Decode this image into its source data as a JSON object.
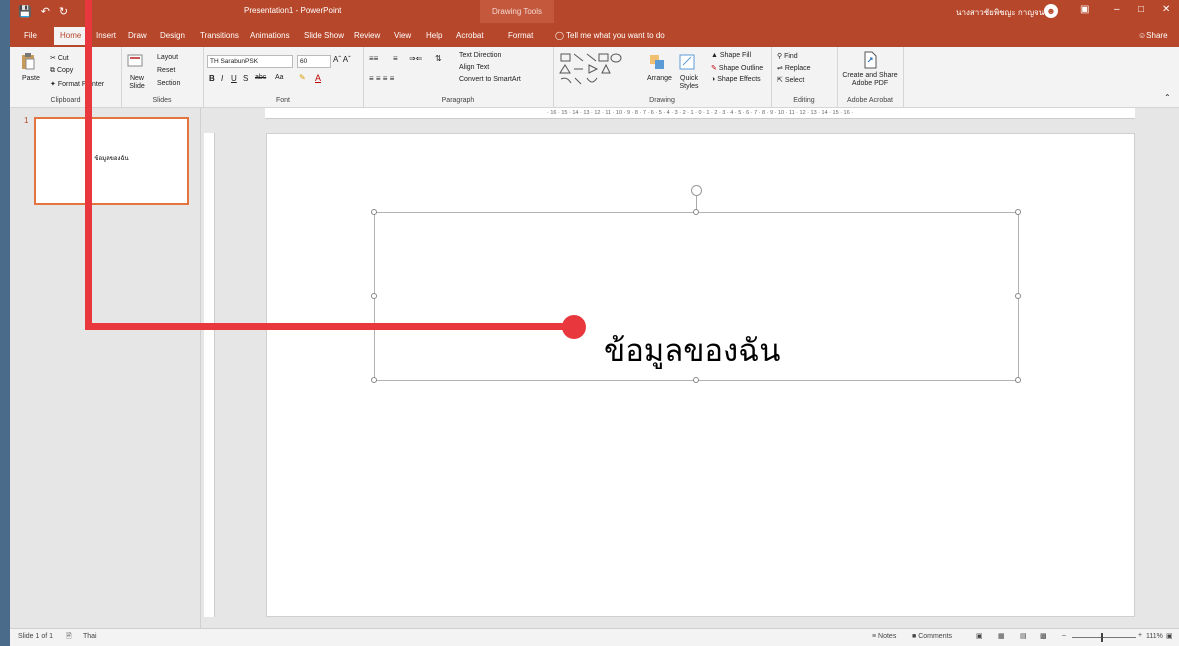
{
  "titlebar": {
    "qat_icons": [
      "save-icon",
      "undo-icon",
      "redo-icon"
    ],
    "app_title": "Presentation1 - PowerPoint",
    "context_tab": "Drawing Tools",
    "user_name": "นางสาวชัยพิชญะ กาญจนา",
    "minimize": "–",
    "restore": "□",
    "close": "✕"
  },
  "tabs": {
    "file": "File",
    "home": "Home",
    "insert": "Insert",
    "draw": "Draw",
    "design": "Design",
    "transitions": "Transitions",
    "animations": "Animations",
    "slideshow": "Slide Show",
    "review": "Review",
    "view": "View",
    "help": "Help",
    "acrobat": "Acrobat",
    "format": "Format",
    "tell_me": "Tell me what you want to do",
    "share": "Share"
  },
  "ribbon": {
    "clipboard": {
      "paste": "Paste",
      "cut": "Cut",
      "copy": "Copy",
      "format_painter": "Format Painter",
      "label": "Clipboard"
    },
    "slides": {
      "new_slide": "New Slide",
      "layout": "Layout",
      "reset": "Reset",
      "section": "Section",
      "label": "Slides"
    },
    "font": {
      "font_name": "TH SarabunPSK",
      "font_size": "60",
      "label": "Font"
    },
    "paragraph": {
      "text_direction": "Text Direction",
      "align_text": "Align Text",
      "convert_smartart": "Convert to SmartArt",
      "label": "Paragraph"
    },
    "drawing": {
      "arrange": "Arrange",
      "quick_styles": "Quick Styles",
      "shape_fill": "Shape Fill",
      "shape_outline": "Shape Outline",
      "shape_effects": "Shape Effects",
      "label": "Drawing"
    },
    "editing": {
      "find": "Find",
      "replace": "Replace",
      "select": "Select",
      "label": "Editing"
    },
    "acrobat": {
      "create_share": "Create and Share Adobe PDF",
      "label": "Adobe Acrobat"
    }
  },
  "ruler": {
    "text": "· 16 · 15 · 14 · 13 · 12 · 11 · 10 · 9 · 8 · 7 · 6 · 5 · 4 · 3 · 2 · 1 · 0 · 1 · 2 · 3 · 4 · 5 · 6 · 7 · 8 · 9 · 10 · 11 · 12 · 13 · 14 · 15 · 16 ·"
  },
  "thumbnails": [
    {
      "number": "1",
      "text": "ข้อมูลของฉัน"
    }
  ],
  "slide": {
    "text": "ข้อมูลของฉัน"
  },
  "status": {
    "slide_info": "Slide 1 of 1",
    "language": "Thai",
    "notes": "Notes",
    "comments": "Comments",
    "zoom_minus": "–",
    "zoom_plus": "+",
    "zoom_level": "111%"
  },
  "colors": {
    "accent": "#b7472a",
    "callout": "#e8383d",
    "thumb_border": "#e3733f"
  }
}
